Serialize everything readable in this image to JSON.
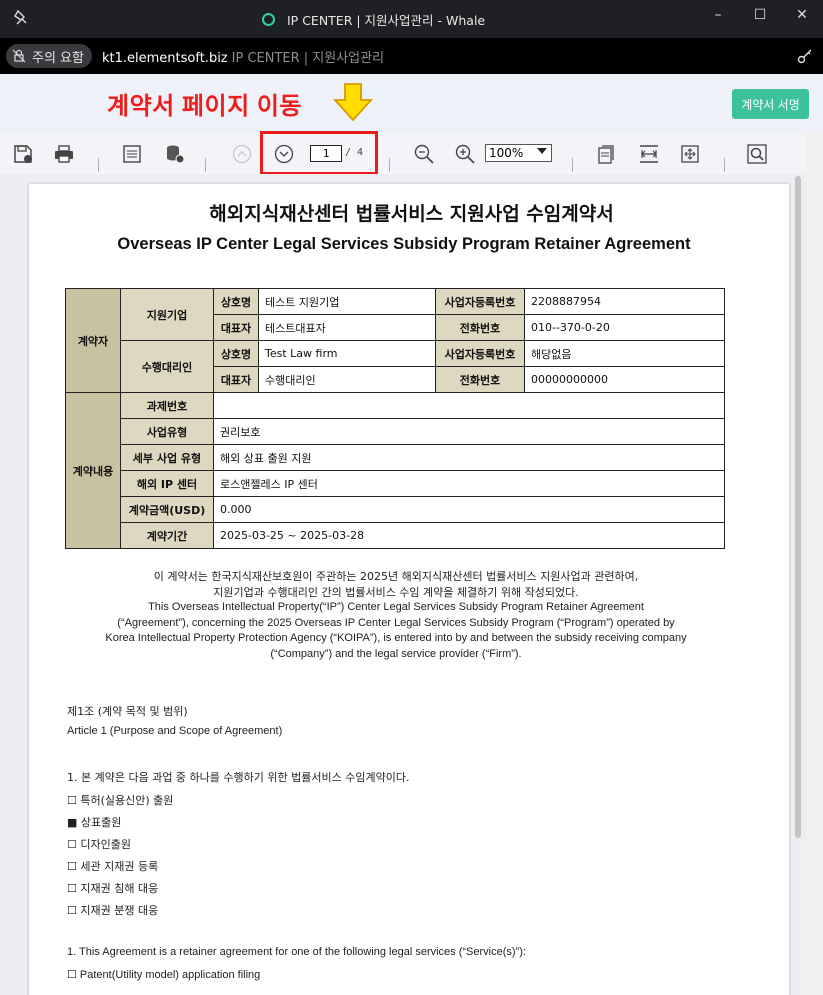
{
  "window": {
    "title": "IP CENTER | 지원사업관리 - Whale",
    "controls": [
      "–",
      "☐",
      "✕"
    ]
  },
  "address_bar": {
    "security_label": "주의 요함",
    "host": "kt1.elementsoft.biz",
    "page_title": "IP CENTER | 지원사업관리"
  },
  "annotation": {
    "text": "계약서 페이지 이동",
    "color": "#f01c1c",
    "arrow_color": "#ffde00"
  },
  "sign_button": {
    "label": "계약서 서명",
    "color": "#3cc29a"
  },
  "pdf_toolbar": {
    "current_page": "1",
    "total_pages": "/ 4",
    "zoom": "100%",
    "icons": [
      "save-icon",
      "print-icon",
      "notes-icon",
      "database-icon",
      "page-up-icon",
      "page-down-icon",
      "zoom-out-icon",
      "zoom-in-icon",
      "fit-page-icon",
      "fit-width-icon",
      "move-icon",
      "find-icon"
    ]
  },
  "document": {
    "title_ko": "해외지식재산센터 법률서비스 지원사업 수임계약서",
    "title_en": "Overseas IP Center Legal Services Subsidy Program Retainer Agreement",
    "parties": {
      "category": "계약자",
      "company": {
        "role": "지원기업",
        "name_label": "상호명",
        "name": "테스트 지원기업",
        "reg_label": "사업자등록번호",
        "reg": "2208887954",
        "rep_label": "대표자",
        "rep": "테스트대표자",
        "phone_label": "전화번호",
        "phone": "010--370-0-20"
      },
      "agent": {
        "role": "수행대리인",
        "name_label": "상호명",
        "name": "Test Law firm",
        "reg_label": "사업자등록번호",
        "reg": "해당없음",
        "rep_label": "대표자",
        "rep": "수행대리인",
        "phone_label": "전화번호",
        "phone": "00000000000"
      }
    },
    "contract": {
      "category": "계약내용",
      "rows": [
        {
          "label": "과제번호",
          "value": ""
        },
        {
          "label": "사업유형",
          "value": "권리보호"
        },
        {
          "label": "세부 사업 유형",
          "value": "해외 상표 출원 지원"
        },
        {
          "label": "해외 IP 센터",
          "value": "로스앤젤레스 IP 센터"
        },
        {
          "label": "계약금액(USD)",
          "value": "0.000"
        },
        {
          "label": "계약기간",
          "value": "2025-03-25 ~ 2025-03-28"
        }
      ]
    },
    "preamble_ko_1": "이 계약서는 한국지식재산보호원이 주관하는 2025년 해외지식재산센터 법률서비스 지원사업과 관련하여,",
    "preamble_ko_2": "지원기업과 수행대리인 간의 법률서비스 수임 계약을 체결하기 위해 작성되었다.",
    "preamble_en_1": "This Overseas Intellectual Property(“IP”) Center Legal Services Subsidy Program Retainer Agreement",
    "preamble_en_2": "(“Agreement”), concerning the 2025 Overseas IP Center Legal Services Subsidy Program (“Program”) operated by",
    "preamble_en_3": "Korea Intellectual Property Protection Agency (“KOIPA”), is entered into by and between the subsidy receiving company",
    "preamble_en_4": "(“Company”) and the legal service provider (“Firm”).",
    "article1_ko": "제1조 (계약 목적 및 범위)",
    "article1_en": "Article 1 (Purpose and Scope of Agreement)",
    "clause1_ko": "1. 본 계약은 다음 과업 중 하나를 수행하기 위한 법률서비스 수임계약이다.",
    "services_ko": [
      "☐ 특허(실용신안) 출원",
      "■ 상표출원",
      "☐ 디자인출원",
      "☐ 세관 지재권 등록",
      "☐ 지재권 침해 대응",
      "☐ 지재권 분쟁 대응"
    ],
    "clause1_en": "1. This Agreement is a retainer agreement for one of the following legal services (“Service(s)”):",
    "services_en": [
      "☐ Patent(Utility model) application filing"
    ]
  }
}
